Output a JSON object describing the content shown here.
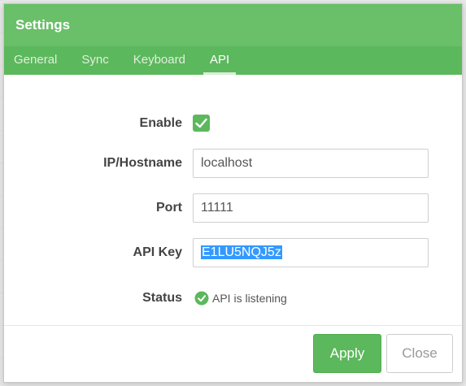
{
  "dialog": {
    "title": "Settings"
  },
  "tabs": [
    {
      "label": "General",
      "active": false
    },
    {
      "label": "Sync",
      "active": false
    },
    {
      "label": "Keyboard",
      "active": false
    },
    {
      "label": "API",
      "active": true
    }
  ],
  "form": {
    "enable": {
      "label": "Enable",
      "checked": true
    },
    "hostname": {
      "label": "IP/Hostname",
      "value": "localhost"
    },
    "port": {
      "label": "Port",
      "value": "11111"
    },
    "api_key": {
      "label": "API Key",
      "value": "E1LU5NQJ5z"
    },
    "status": {
      "label": "Status",
      "text": "API is listening",
      "icon": "check-circle-icon"
    }
  },
  "footer": {
    "apply_label": "Apply",
    "close_label": "Close"
  },
  "colors": {
    "header": "#6abf69",
    "tabbar": "#5cb85c",
    "accent": "#5cb85c",
    "selection": "#3399ff"
  }
}
